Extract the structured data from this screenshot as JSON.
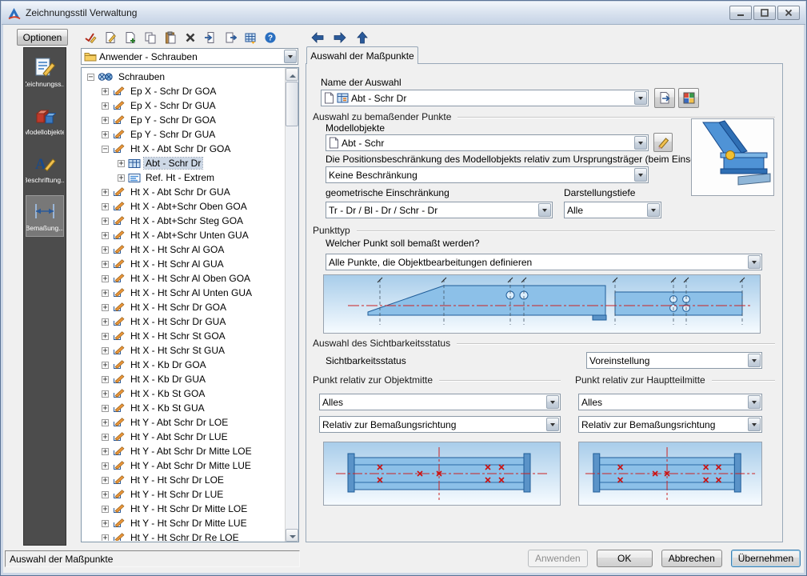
{
  "window": {
    "title": "Zeichnungsstil Verwaltung",
    "controls": [
      {
        "icon": "minimize-icon"
      },
      {
        "icon": "maximize-icon"
      },
      {
        "icon": "close-icon"
      }
    ]
  },
  "colors": {
    "accent_blue": "#2a5a9a",
    "preview_beam_blue": "#8cc0e8",
    "marker_red": "#cc2222",
    "sidebar_gray": "#4c4c4c"
  },
  "toolbar": {
    "options_label": "Optionen",
    "buttons": [
      {
        "icon": "edit-check-icon"
      },
      {
        "icon": "edit-page-icon"
      },
      {
        "icon": "new-page-icon"
      },
      {
        "icon": "copy-icon"
      },
      {
        "icon": "paste-icon"
      },
      {
        "icon": "delete-icon"
      },
      {
        "icon": "import-icon"
      },
      {
        "icon": "export-icon"
      },
      {
        "icon": "transfer-icon"
      },
      {
        "icon": "help-icon"
      }
    ],
    "nav": [
      {
        "icon": "back-arrow-icon"
      },
      {
        "icon": "forward-arrow-icon"
      },
      {
        "icon": "up-arrow-icon"
      }
    ]
  },
  "sidebar": {
    "items": [
      {
        "label": "Zeichnungss...",
        "icon": "drawing-style-icon",
        "selected": false
      },
      {
        "label": "Modellobjekte",
        "icon": "model-objects-icon",
        "selected": false
      },
      {
        "label": "Beschriftung...",
        "icon": "annotation-icon",
        "selected": false
      },
      {
        "label": "Bemaßung...",
        "icon": "dimension-icon",
        "selected": true
      }
    ]
  },
  "tree": {
    "combo_value": "Anwender - Schrauben",
    "items": [
      {
        "label": "Schrauben",
        "level": 0,
        "expand": "minus",
        "icon": "bolts",
        "selected": false
      },
      {
        "label": "Ep X - Schr Dr GOA",
        "level": 1,
        "expand": "plus",
        "icon": "dim",
        "selected": false
      },
      {
        "label": "Ep X - Schr Dr GUA",
        "level": 1,
        "expand": "plus",
        "icon": "dim",
        "selected": false
      },
      {
        "label": "Ep Y - Schr Dr GOA",
        "level": 1,
        "expand": "plus",
        "icon": "dim",
        "selected": false
      },
      {
        "label": "Ep Y - Schr Dr GUA",
        "level": 1,
        "expand": "plus",
        "icon": "dim",
        "selected": false
      },
      {
        "label": "Ht X - Abt Schr Dr GOA",
        "level": 1,
        "expand": "minus",
        "icon": "dim",
        "selected": false
      },
      {
        "label": "Abt - Schr Dr",
        "level": 2,
        "expand": "plus",
        "icon": "table",
        "selected": true
      },
      {
        "label": "Ref. Ht - Extrem",
        "level": 2,
        "expand": "plus",
        "icon": "ref",
        "selected": false
      },
      {
        "label": "Ht X - Abt Schr Dr GUA",
        "level": 1,
        "expand": "plus",
        "icon": "dim",
        "selected": false
      },
      {
        "label": "Ht X - Abt+Schr Oben GOA",
        "level": 1,
        "expand": "plus",
        "icon": "dim",
        "selected": false
      },
      {
        "label": "Ht X - Abt+Schr Steg GOA",
        "level": 1,
        "expand": "plus",
        "icon": "dim",
        "selected": false
      },
      {
        "label": "Ht X - Abt+Schr Unten GUA",
        "level": 1,
        "expand": "plus",
        "icon": "dim",
        "selected": false
      },
      {
        "label": "Ht X - Ht Schr Al GOA",
        "level": 1,
        "expand": "plus",
        "icon": "dim",
        "selected": false
      },
      {
        "label": "Ht X - Ht Schr Al GUA",
        "level": 1,
        "expand": "plus",
        "icon": "dim",
        "selected": false
      },
      {
        "label": "Ht X - Ht Schr Al Oben GOA",
        "level": 1,
        "expand": "plus",
        "icon": "dim",
        "selected": false
      },
      {
        "label": "Ht X - Ht Schr Al Unten GUA",
        "level": 1,
        "expand": "plus",
        "icon": "dim",
        "selected": false
      },
      {
        "label": "Ht X - Ht Schr Dr GOA",
        "level": 1,
        "expand": "plus",
        "icon": "dim",
        "selected": false
      },
      {
        "label": "Ht X - Ht Schr Dr GUA",
        "level": 1,
        "expand": "plus",
        "icon": "dim",
        "selected": false
      },
      {
        "label": "Ht X - Ht Schr St GOA",
        "level": 1,
        "expand": "plus",
        "icon": "dim",
        "selected": false
      },
      {
        "label": "Ht X - Ht Schr St GUA",
        "level": 1,
        "expand": "plus",
        "icon": "dim",
        "selected": false
      },
      {
        "label": "Ht X - Kb Dr GOA",
        "level": 1,
        "expand": "plus",
        "icon": "dim",
        "selected": false
      },
      {
        "label": "Ht X - Kb Dr GUA",
        "level": 1,
        "expand": "plus",
        "icon": "dim",
        "selected": false
      },
      {
        "label": "Ht X - Kb St GOA",
        "level": 1,
        "expand": "plus",
        "icon": "dim",
        "selected": false
      },
      {
        "label": "Ht X - Kb St GUA",
        "level": 1,
        "expand": "plus",
        "icon": "dim",
        "selected": false
      },
      {
        "label": "Ht Y - Abt Schr Dr LOE",
        "level": 1,
        "expand": "plus",
        "icon": "dim",
        "selected": false
      },
      {
        "label": "Ht Y - Abt Schr Dr LUE",
        "level": 1,
        "expand": "plus",
        "icon": "dim",
        "selected": false
      },
      {
        "label": "Ht Y - Abt Schr Dr Mitte LOE",
        "level": 1,
        "expand": "plus",
        "icon": "dim",
        "selected": false
      },
      {
        "label": "Ht Y - Abt Schr Dr Mitte LUE",
        "level": 1,
        "expand": "plus",
        "icon": "dim",
        "selected": false
      },
      {
        "label": "Ht Y - Ht Schr Dr LOE",
        "level": 1,
        "expand": "plus",
        "icon": "dim",
        "selected": false
      },
      {
        "label": "Ht Y - Ht Schr Dr LUE",
        "level": 1,
        "expand": "plus",
        "icon": "dim",
        "selected": false
      },
      {
        "label": "Ht Y - Ht Schr Dr Mitte LOE",
        "level": 1,
        "expand": "plus",
        "icon": "dim",
        "selected": false
      },
      {
        "label": "Ht Y - Ht Schr Dr Mitte LUE",
        "level": 1,
        "expand": "plus",
        "icon": "dim",
        "selected": false
      },
      {
        "label": "Ht Y - Ht Schr Dr Re LOE",
        "level": 1,
        "expand": "plus",
        "icon": "dim",
        "selected": false
      }
    ]
  },
  "panel": {
    "tab": "Auswahl der Maßpunkte",
    "name_label": "Name der Auswahl",
    "name_value": "Abt - Schr Dr",
    "group_points": {
      "title": "Auswahl zu bemaßender Punkte",
      "model_label": "Modellobjekte",
      "model_value": "Abt - Schr",
      "position_label": "Die Positionsbeschränkung des Modellobjekts relativ zum Ursprungsträger (beim Einsetzen)",
      "position_value": "Keine Beschränkung",
      "geometric_label": "geometrische Einschränkung",
      "geometric_value": "Tr - Dr / Bl - Dr / Schr - Dr",
      "depth_label": "Darstellungstiefe",
      "depth_value": "Alle"
    },
    "group_pointtype": {
      "title": "Punkttyp",
      "question": "Welcher Punkt soll bemaßt werden?",
      "value": "Alle Punkte, die Objektbearbeitungen definieren"
    },
    "group_visibility": {
      "title": "Auswahl des Sichtbarkeitsstatus",
      "label": "Sichtbarkeitsstatus",
      "value": "Voreinstellung"
    },
    "group_object_center": {
      "title": "Punkt relativ zur Objektmitte",
      "combo1": "Alles",
      "combo2": "Relativ zur Bemaßungsrichtung"
    },
    "group_main_center": {
      "title": "Punkt relativ zur Hauptteilmitte",
      "combo1": "Alles",
      "combo2": "Relativ zur Bemaßungsrichtung"
    }
  },
  "footer": {
    "status": "Auswahl der Maßpunkte",
    "buttons": [
      {
        "label": "Anwenden",
        "enabled": false,
        "default": false
      },
      {
        "label": "OK",
        "enabled": true,
        "default": false
      },
      {
        "label": "Abbrechen",
        "enabled": true,
        "default": false
      },
      {
        "label": "Übernehmen",
        "enabled": true,
        "default": true
      }
    ]
  }
}
